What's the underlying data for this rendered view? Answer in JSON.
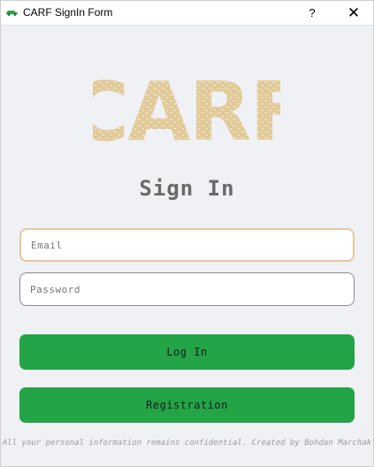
{
  "window": {
    "title": "CARF SignIn Form",
    "help_label": "?",
    "close_label": "✕"
  },
  "logo": {
    "text": "CARF",
    "color": "#e2ca97"
  },
  "form": {
    "heading": "Sign In",
    "email_placeholder": "Email",
    "password_placeholder": "Password",
    "login_label": "Log In",
    "registration_label": "Registration"
  },
  "footer": {
    "text": "All your personal information remains confidential. Created by Bohdan Marchak"
  },
  "colors": {
    "accent": "#22a447",
    "background": "#f0f1f5",
    "logo": "#e2ca97"
  },
  "icons": {
    "app": "car-icon",
    "help": "help-icon",
    "close": "close-icon"
  }
}
